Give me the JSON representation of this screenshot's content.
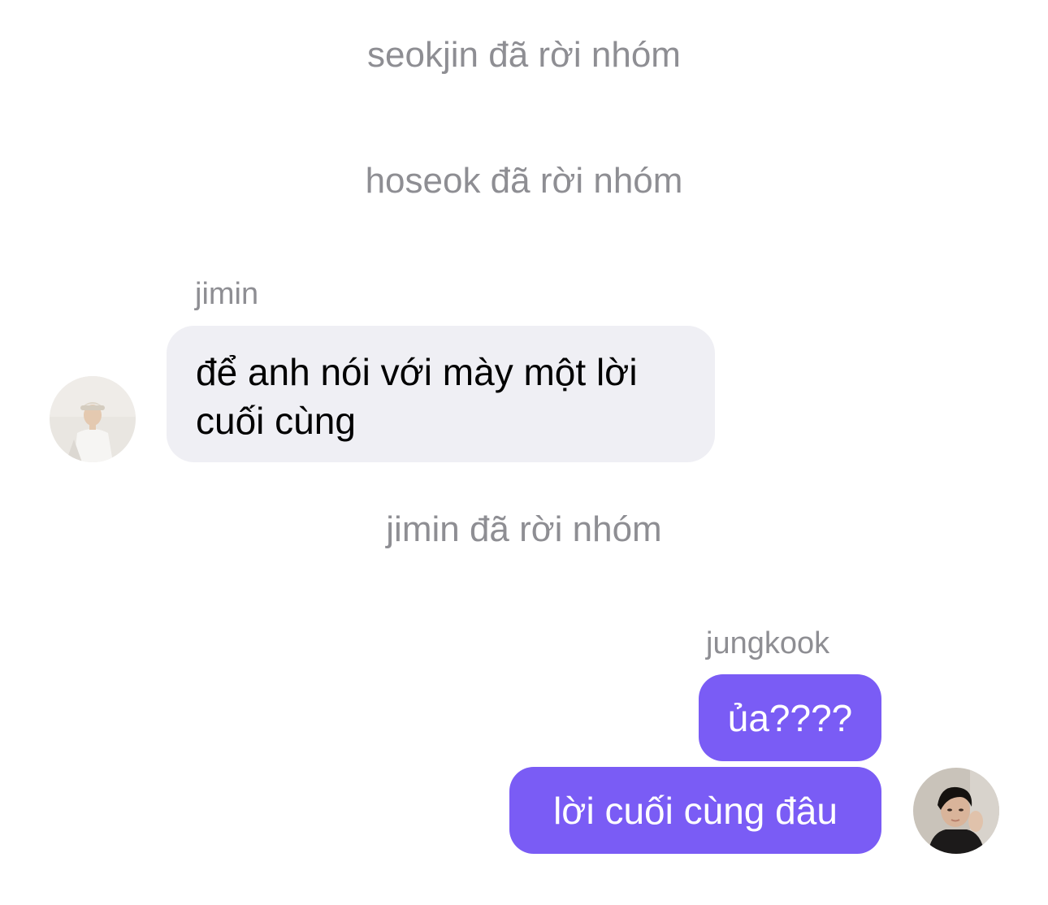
{
  "chat": {
    "events": {
      "seokjin_left": "seokjin đã rời nhóm",
      "hoseok_left": "hoseok đã rời nhóm",
      "jimin_left": "jimin đã rời nhóm"
    },
    "jimin": {
      "name": "jimin",
      "avatar_icon": "person-photo-avatar",
      "message": "để anh nói với mày một lời cuối cùng"
    },
    "jungkook": {
      "name": "jungkook",
      "avatar_icon": "person-photo-avatar",
      "messages": [
        "ủa????",
        "lời cuối cùng đâu"
      ]
    }
  },
  "colors": {
    "incoming_bubble": "#efeff4",
    "outgoing_bubble": "#7a5cf5",
    "meta_text": "#8e8e93"
  }
}
